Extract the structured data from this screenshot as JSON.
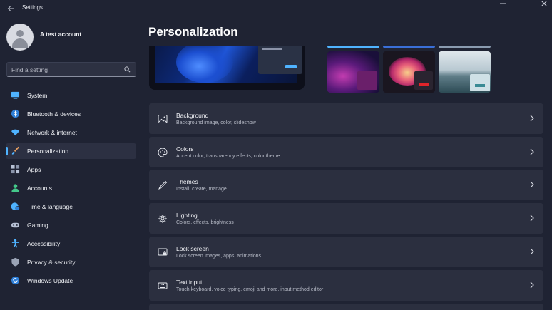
{
  "window": {
    "title": "Settings",
    "back_icon": "arrow-left-icon",
    "controls": [
      "minimize-icon",
      "maximize-icon",
      "close-icon"
    ]
  },
  "profile": {
    "name": "A test account"
  },
  "search": {
    "placeholder": "Find a setting"
  },
  "sidebar": {
    "items": [
      {
        "label": "System",
        "icon": "monitor-icon",
        "color": "#4fb3ff"
      },
      {
        "label": "Bluetooth & devices",
        "icon": "bluetooth-icon",
        "color": "#4fb3ff"
      },
      {
        "label": "Network & internet",
        "icon": "wifi-icon",
        "color": "#4fb3ff"
      },
      {
        "label": "Personalization",
        "icon": "brush-icon",
        "color": "#e8a062",
        "active": true
      },
      {
        "label": "Apps",
        "icon": "apps-icon",
        "color": "#b8c2d6"
      },
      {
        "label": "Accounts",
        "icon": "person-icon",
        "color": "#44c88a"
      },
      {
        "label": "Time & language",
        "icon": "globe-clock-icon",
        "color": "#4fb3ff"
      },
      {
        "label": "Gaming",
        "icon": "gamepad-icon",
        "color": "#b8c2d6"
      },
      {
        "label": "Accessibility",
        "icon": "accessibility-icon",
        "color": "#4fb3ff"
      },
      {
        "label": "Privacy & security",
        "icon": "shield-icon",
        "color": "#9aa3b5"
      },
      {
        "label": "Windows Update",
        "icon": "update-icon",
        "color": "#4fb3ff"
      }
    ]
  },
  "main": {
    "title": "Personalization",
    "cards": [
      {
        "title": "Background",
        "subtitle": "Background image, color, slideshow",
        "icon": "image-icon"
      },
      {
        "title": "Colors",
        "subtitle": "Accent color, transparency effects, color theme",
        "icon": "palette-icon"
      },
      {
        "title": "Themes",
        "subtitle": "Install, create, manage",
        "icon": "pen-icon"
      },
      {
        "title": "Lighting",
        "subtitle": "Colors, effects, brightness",
        "icon": "gear-icon"
      },
      {
        "title": "Lock screen",
        "subtitle": "Lock screen images, apps, animations",
        "icon": "lock-screen-icon"
      },
      {
        "title": "Text input",
        "subtitle": "Touch keyboard, voice typing, emoji and more, input method editor",
        "icon": "keyboard-icon"
      }
    ]
  },
  "colors": {
    "background": "#1f2333",
    "card": "#2b2f3f",
    "accent": "#4fb3ff"
  }
}
